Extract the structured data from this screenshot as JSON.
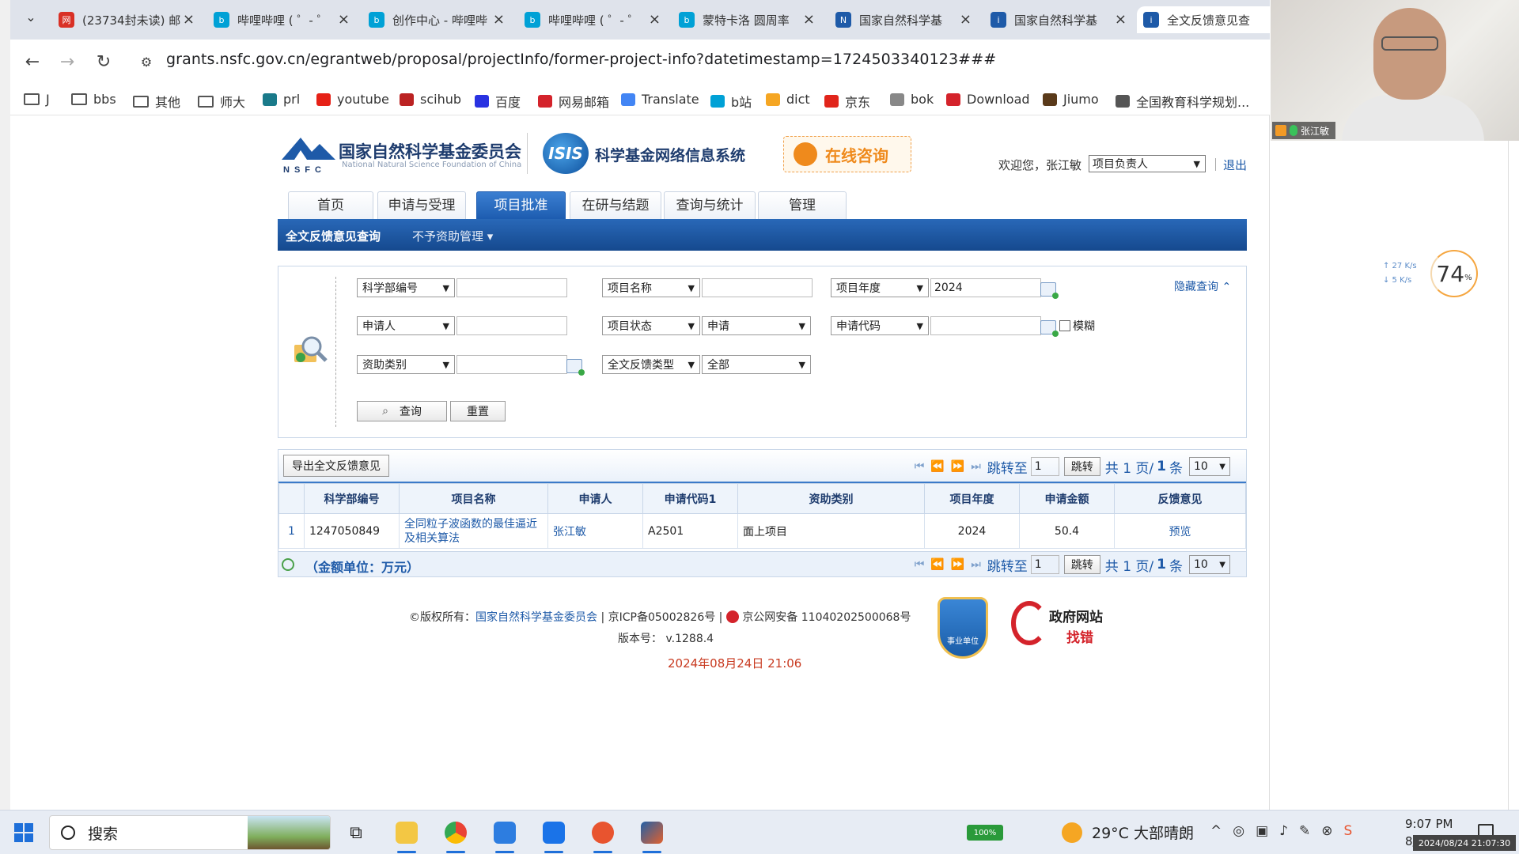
{
  "browser": {
    "tabs": [
      {
        "title": "(23734封未读) 邮",
        "icon_color": "#d93025",
        "icon_glyph": "网"
      },
      {
        "title": "哔哩哔哩 ( ゜- ゜",
        "icon_color": "#00a1d6",
        "icon_glyph": "b"
      },
      {
        "title": "创作中心 - 哔哩哔",
        "icon_color": "#00a1d6",
        "icon_glyph": "b"
      },
      {
        "title": "哔哩哔哩 ( ゜- ゜",
        "icon_color": "#00a1d6",
        "icon_glyph": "b"
      },
      {
        "title": "蒙特卡洛 圆周率",
        "icon_color": "#00a1d6",
        "icon_glyph": "b"
      },
      {
        "title": "国家自然科学基",
        "icon_color": "#1e5aa8",
        "icon_glyph": "N"
      },
      {
        "title": "国家自然科学基",
        "icon_color": "#1e5aa8",
        "icon_glyph": "i"
      },
      {
        "title": "全文反馈意见查",
        "icon_color": "#1e5aa8",
        "icon_glyph": "i"
      }
    ],
    "url": "grants.nsfc.gov.cn/egrantweb/proposal/projectInfo/former-project-info?datetimestamp=1724503340123###",
    "bookmarks": [
      {
        "label": "J",
        "icon": "folder-icon"
      },
      {
        "label": "bbs",
        "icon": "folder-icon"
      },
      {
        "label": "其他",
        "icon": "folder-icon"
      },
      {
        "label": "师大",
        "icon": "folder-icon"
      },
      {
        "label": "prl",
        "icon": "prl-icon"
      },
      {
        "label": "youtube",
        "icon": "youtube-icon"
      },
      {
        "label": "scihub",
        "icon": "scihub-icon"
      },
      {
        "label": "百度",
        "icon": "baidu-icon"
      },
      {
        "label": "网易邮箱",
        "icon": "mail-icon"
      },
      {
        "label": "Translate",
        "icon": "translate-icon"
      },
      {
        "label": "b站",
        "icon": "bilibili-icon"
      },
      {
        "label": "dict",
        "icon": "dict-icon"
      },
      {
        "label": "京东",
        "icon": "jd-icon"
      },
      {
        "label": "bok",
        "icon": "v-icon"
      },
      {
        "label": "Download",
        "icon": "download-icon"
      },
      {
        "label": "Jiumo",
        "icon": "jiumo-icon"
      },
      {
        "label": "全国教育科学规划...",
        "icon": "globe-icon"
      }
    ]
  },
  "site": {
    "org_name": "国家自然科学基金委员会",
    "org_name_en": "National Natural Science Foundation of China",
    "logo_text": "NSFC",
    "isis_text": "ISIS",
    "system_name": "科学基金网络信息系统",
    "consult_label": "在线咨询",
    "welcome": "欢迎您，张江敏",
    "role": "项目负责人",
    "logout": "退出",
    "main_tabs": [
      "首页",
      "申请与受理",
      "项目批准",
      "在研与结题",
      "查询与统计",
      "管理"
    ],
    "sub_nav": {
      "active": "全文反馈意见查询",
      "other": "不予资助管理 ▾"
    }
  },
  "search": {
    "hide_label": "隐藏查询 ⌃",
    "row1": {
      "field1": "科学部编号",
      "value1": "",
      "field2": "项目名称",
      "value2": "",
      "field3": "项目年度",
      "value3": "2024"
    },
    "row2": {
      "field1": "申请人",
      "value1": "",
      "field2": "项目状态",
      "value2": "申请",
      "field3": "申请代码",
      "value3": "",
      "fuzzy_label": "模糊"
    },
    "row3": {
      "field1": "资助类别",
      "value1": "",
      "field2": "全文反馈类型",
      "value2": "全部"
    },
    "query_button": "查询",
    "reset_button": "重置"
  },
  "results": {
    "export_button": "导出全文反馈意见",
    "pager": {
      "jump_label": "跳转至",
      "page_input": "1",
      "go_button": "跳转",
      "total_prefix": "共 1 页/",
      "total_count": "1",
      "total_suffix": "条",
      "page_size": "10"
    },
    "columns": [
      "",
      "科学部编号",
      "项目名称",
      "申请人",
      "申请代码1",
      "资助类别",
      "项目年度",
      "申请金额",
      "反馈意见"
    ],
    "rows": [
      {
        "index": "1",
        "dept_code": "1247050849",
        "project_name": "全同粒子波函数的最佳逼近及相关算法",
        "applicant": "张江敏",
        "apply_code": "A2501",
        "funding_type": "面上项目",
        "year": "2024",
        "amount": "50.4",
        "feedback": "预览"
      }
    ],
    "unit_note": "（金额单位：万元）"
  },
  "footer": {
    "copyright_prefix": "©版权所有：",
    "copyright_org": "国家自然科学基金委员会",
    "icp": "| 京ICP备05002826号 |",
    "police": "京公网安备 11040202500068号",
    "version": "版本号： v.1288.4",
    "datetime": "2024年08月24日 21:06",
    "badge_text": "事业单位",
    "gov_line1": "政府网站",
    "gov_line2": "找错"
  },
  "overlay": {
    "webcam_name": "张江敏",
    "net_up": "↑ 27  K/s",
    "net_down": "↓ 5   K/s",
    "gauge_value": "74",
    "gauge_unit": "%"
  },
  "taskbar": {
    "search_placeholder": "搜索",
    "battery": "100%",
    "weather": "29°C 大部晴朗",
    "time": "9:07 PM",
    "date_prefix": "8/",
    "date_overlay": "2024/08/24 21:07:30"
  }
}
